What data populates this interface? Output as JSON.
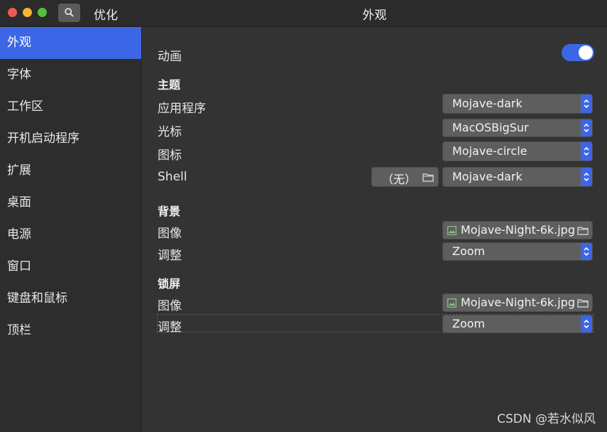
{
  "app": {
    "name": "优化",
    "window_title": "外观"
  },
  "sidebar": {
    "items": [
      {
        "label": "外观",
        "active": true
      },
      {
        "label": "字体"
      },
      {
        "label": "工作区"
      },
      {
        "label": "开机启动程序"
      },
      {
        "label": "扩展"
      },
      {
        "label": "桌面"
      },
      {
        "label": "电源"
      },
      {
        "label": "窗口"
      },
      {
        "label": "键盘和鼠标"
      },
      {
        "label": "顶栏"
      }
    ]
  },
  "main": {
    "animation": {
      "label": "动画",
      "enabled": true
    },
    "themes": {
      "heading": "主题",
      "applications": {
        "label": "应用程序",
        "value": "Mojave-dark"
      },
      "cursor": {
        "label": "光标",
        "value": "MacOSBigSur"
      },
      "icons": {
        "label": "图标",
        "value": "Mojave-circle"
      },
      "shell": {
        "label": "Shell",
        "file_value": "（无）",
        "value": "Mojave-dark"
      }
    },
    "background": {
      "heading": "背景",
      "image": {
        "label": "图像",
        "value": "Mojave-Night-6k.jpg"
      },
      "adjustment": {
        "label": "调整",
        "value": "Zoom"
      }
    },
    "lock_screen": {
      "heading": "锁屏",
      "image": {
        "label": "图像",
        "value": "Mojave-Night-6k.jpg"
      },
      "adjustment": {
        "label": "调整",
        "value": "Zoom"
      }
    }
  },
  "watermark": "CSDN @若水似风",
  "colors": {
    "accent": "#3d66e6",
    "close": "#ed5a56",
    "minimize": "#f5b432",
    "maximize": "#56c03d"
  }
}
